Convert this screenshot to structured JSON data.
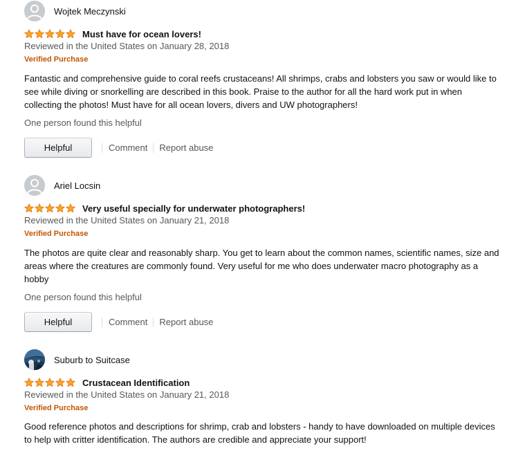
{
  "reviews": [
    {
      "profile_name": "Wojtek Meczynski",
      "avatar": "default-avatar",
      "rating": 5,
      "rating_max": 5,
      "title": "Must have for ocean lovers!",
      "date": "Reviewed in the United States on January 28, 2018",
      "verified": "Verified Purchase",
      "body": "Fantastic and comprehensive guide to coral reefs crustaceans! All shrimps, crabs and lobsters you saw or would like to see while diving or snorkelling are described in this book. Praise to the author for all the hard work put in when collecting the photos! Must have for all ocean lovers, divers and UW photographers!",
      "helpful_count": "One person found this helpful",
      "helpful_label": "Helpful",
      "comment_label": "Comment",
      "report_label": "Report abuse"
    },
    {
      "profile_name": "Ariel Locsin",
      "avatar": "default-avatar",
      "rating": 5,
      "rating_max": 5,
      "title": "Very useful specially for underwater photographers!",
      "date": "Reviewed in the United States on January 21, 2018",
      "verified": "Verified Purchase",
      "body": "The photos are quite clear and reasonably sharp. You get to learn about the common names, scientific names, size and areas where the creatures are commonly found. Very useful for me who does underwater macro photography as a hobby",
      "helpful_count": "One person found this helpful",
      "helpful_label": "Helpful",
      "comment_label": "Comment",
      "report_label": "Report abuse"
    },
    {
      "profile_name": "Suburb to Suitcase",
      "avatar": "photo-avatar",
      "rating": 5,
      "rating_max": 5,
      "title": "Crustacean Identification",
      "date": "Reviewed in the United States on January 21, 2018",
      "verified": "Verified Purchase",
      "body": "Good reference photos and descriptions for shrimp, crab and lobsters - handy to have downloaded on multiple devices to help with critter identification. The authors are credible and appreciate your support!"
    }
  ],
  "colors": {
    "star_fill": "#ffa41c",
    "star_stroke": "#de7921",
    "verified": "#c45500",
    "meta_text": "#565959"
  }
}
